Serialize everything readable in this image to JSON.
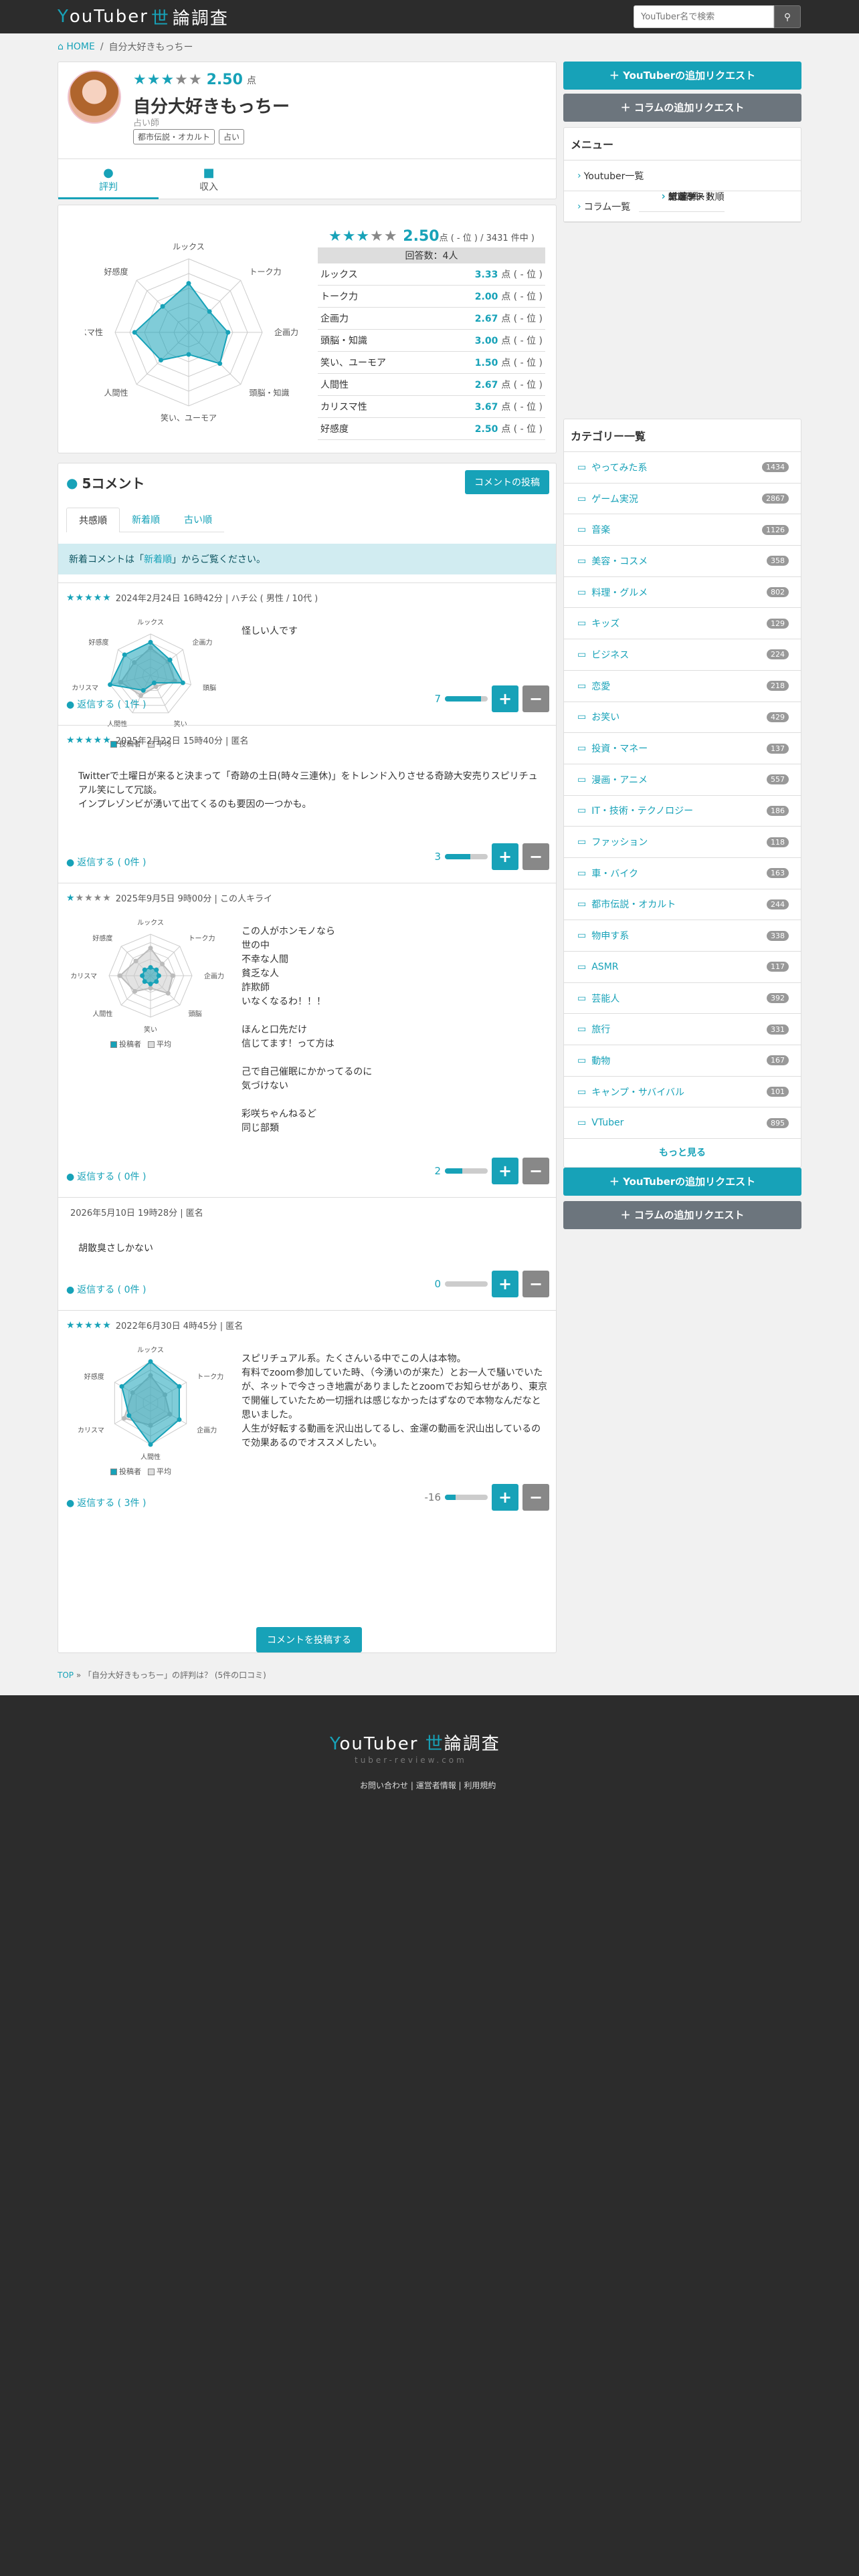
{
  "header": {
    "logo_y": "Y",
    "logo_text": "ouTuber",
    "logo_kanji_w": "世",
    "logo_kanji_rest": "論調査",
    "search_placeholder": "YouTuber名で検索",
    "search_icon": "search-icon"
  },
  "breadcrumb": {
    "home": "HOME",
    "sep": "/",
    "current": "自分大好きもっちー"
  },
  "profile": {
    "score": "2.50",
    "score_unit": "点",
    "stars_on": "★★★",
    "stars_off": "★★",
    "name": "自分大好きもっちー",
    "genre": "占い師",
    "tags": [
      "都市伝説・オカルト",
      "占い"
    ],
    "tabs": [
      {
        "label": "評判",
        "icon": "comment-icon"
      },
      {
        "label": "収入",
        "icon": "money-icon"
      }
    ]
  },
  "rating_summary": {
    "stars_on": "★★★",
    "stars_off": "★★",
    "score": "2.50",
    "rank_text": "点 ( - 位 ) ",
    "rank_total": "/ 3431 件中 )",
    "respondents": "回答数：4人",
    "rows": [
      {
        "label": "ルックス",
        "value": "3.33",
        "rank": "点 ( - 位 )"
      },
      {
        "label": "トーク力",
        "value": "2.00",
        "rank": "点 ( - 位 )"
      },
      {
        "label": "企画力",
        "value": "2.67",
        "rank": "点 ( - 位 )"
      },
      {
        "label": "頭脳・知識",
        "value": "3.00",
        "rank": "点 ( - 位 )"
      },
      {
        "label": "笑い、ユーモア",
        "value": "1.50",
        "rank": "点 ( - 位 )"
      },
      {
        "label": "人間性",
        "value": "2.67",
        "rank": "点 ( - 位 )"
      },
      {
        "label": "カリスマ性",
        "value": "3.67",
        "rank": "点 ( - 位 )"
      },
      {
        "label": "好感度",
        "value": "2.50",
        "rank": "点 ( - 位 )"
      }
    ],
    "radar_labels": [
      "ルックス",
      "トーク力",
      "企画力",
      "頭脳・知識",
      "笑い、ユーモア",
      "人間性",
      "カリスマ性",
      "好感度"
    ]
  },
  "chart_data": [
    {
      "type": "radar",
      "categories": [
        "ルックス",
        "トーク力",
        "企画力",
        "頭脳・知識",
        "笑い、ユーモア",
        "人間性",
        "カリスマ性",
        "好感度"
      ],
      "series": [
        {
          "values": [
            3.33,
            2.0,
            2.67,
            3.0,
            1.5,
            2.67,
            3.67,
            2.5
          ]
        }
      ],
      "ylim": [
        0,
        5
      ]
    }
  ],
  "comments_section": {
    "title": "5コメント",
    "post_button": "コメントの投稿",
    "sort_tabs": [
      "共感順",
      "新着順",
      "古い順"
    ],
    "notice_before": "新着コメントは「",
    "notice_link": "新着順",
    "notice_after": "」からご覧ください。",
    "bottom_post": "コメントを投稿する",
    "legend_user": "投稿者",
    "legend_avg": "平均"
  },
  "comments": [
    {
      "stars_on": "★★★★★",
      "stars_off": "",
      "meta": "2024年2月24日 16時42分 | ハチ公 ( 男性 / 10代 )",
      "text": "怪しい人です",
      "reply": "返信する ( 1件 )",
      "votes": "7",
      "vote_ratio": 0.85,
      "radar_labels": [
        "ルックス",
        "企画力",
        "頭脳",
        "笑い",
        "人間性",
        "カリスマ",
        "好感度"
      ],
      "radar_user": [
        4,
        3,
        4,
        1,
        2,
        5,
        4
      ],
      "radar_avg": [
        3.33,
        2.67,
        3.0,
        1.5,
        2.67,
        3.67,
        2.5
      ]
    },
    {
      "stars_on": "★★★★★",
      "stars_off": "",
      "meta": "2025年2月22日 15時40分 | 匿名",
      "text": "Twitterで土曜日が来ると決まって「奇跡の土日(時々三連休)」をトレンド入りさせる奇跡大安売りスピリチュアル笑にして冗談。\nインプレゾンビが湧いて出てくるのも要因の一つかも。",
      "reply": "返信する ( 0件 )",
      "votes": "3",
      "vote_ratio": 0.6
    },
    {
      "stars_on": "★",
      "stars_off": "★★★★",
      "meta": "2025年9月5日 9時00分 | この人キライ",
      "text": "この人がホンモノなら\n世の中\n不幸な人間\n貧乏な人\n詐欺師\nいなくなるわ！！！\n\nほんと口先だけ\n信じてます！って方は\n\n己で自己催眠にかかってるのに\n気づけない\n\n彩咲ちゃんねるど\n同じ部類",
      "reply": "返信する ( 0件 )",
      "votes": "2",
      "vote_ratio": 0.4,
      "radar_labels": [
        "ルックス",
        "トーク力",
        "企画力",
        "頭脳",
        "笑い",
        "人間性",
        "カリスマ",
        "好感度"
      ],
      "radar_user": [
        1,
        1,
        1,
        1,
        1,
        1,
        1,
        1
      ],
      "radar_avg": [
        3.33,
        2.0,
        2.67,
        3.0,
        1.5,
        2.67,
        3.67,
        2.5
      ]
    },
    {
      "stars_on": "",
      "stars_off": "",
      "meta": "2026年5月10日 19時28分 | 匿名",
      "text": "胡散臭さしかない",
      "reply": "返信する ( 0件 )",
      "votes": "0",
      "vote_ratio": 0.0
    },
    {
      "stars_on": "★★★★★",
      "stars_off": "",
      "meta": "2022年6月30日 4時45分 | 匿名",
      "text": "スピリチュアル系。たくさんいる中でこの人は本物。\n有料でzoom参加していた時、（今湧いのが来た）とお一人で騒いでいたが、ネットで今さっき地震がありましたとzoomでお知らせがあり、東京で開催していたため一切揺れは感じなかったはずなので本物なんだなと思いました。\n人生が好転する動画を沢山出してるし、金運の動画を沢山出しているので効果あるのでオススメしたい。",
      "reply": "返信する ( 3件 )",
      "votes": "-16",
      "vote_ratio": 0.25,
      "radar_labels": [
        "ルックス",
        "トーク力",
        "企画力",
        "人間性",
        "カリスマ",
        "好感度"
      ],
      "radar_user": [
        5,
        4,
        4,
        5,
        3,
        4
      ],
      "radar_avg": [
        3.33,
        2.0,
        2.67,
        2.67,
        3.67,
        2.5
      ]
    }
  ],
  "footer_crumb": {
    "top": "TOP",
    "sep": "»",
    "text": "「自分大好きもっちー」の評判は？ (5件の口コミ)"
  },
  "sidebar": {
    "add_youtuber": "YouTuberの追加リクエスト",
    "add_column": "コラムの追加リクエスト",
    "menu_title": "メニュー",
    "menu": [
      {
        "label": "Youtuber一覧",
        "sub": false
      },
      {
        "label": "50音順",
        "sub": true
      },
      {
        "label": "コメント数順",
        "sub": true
      },
      {
        "label": "新着",
        "sub": true
      },
      {
        "label": "コラム一覧",
        "sub": false
      },
      {
        "label": "総選挙",
        "sub": true
      },
      {
        "label": "アンケート",
        "sub": true
      },
      {
        "label": "ニュース",
        "sub": true
      }
    ],
    "category_title": "カテゴリー一覧",
    "categories": [
      {
        "label": "やってみた系",
        "count": "1434"
      },
      {
        "label": "ゲーム実況",
        "count": "2867"
      },
      {
        "label": "音楽",
        "count": "1126"
      },
      {
        "label": "美容・コスメ",
        "count": "358"
      },
      {
        "label": "料理・グルメ",
        "count": "802"
      },
      {
        "label": "キッズ",
        "count": "129"
      },
      {
        "label": "ビジネス",
        "count": "224"
      },
      {
        "label": "恋愛",
        "count": "218"
      },
      {
        "label": "お笑い",
        "count": "429"
      },
      {
        "label": "投資・マネー",
        "count": "137"
      },
      {
        "label": "漫画・アニメ",
        "count": "557"
      },
      {
        "label": "IT・技術・テクノロジー",
        "count": "186"
      },
      {
        "label": "ファッション",
        "count": "118"
      },
      {
        "label": "車・バイク",
        "count": "163"
      },
      {
        "label": "都市伝説・オカルト",
        "count": "244"
      },
      {
        "label": "物申す系",
        "count": "338"
      },
      {
        "label": "ASMR",
        "count": "117"
      },
      {
        "label": "芸能人",
        "count": "392"
      },
      {
        "label": "旅行",
        "count": "331"
      },
      {
        "label": "動物",
        "count": "167"
      },
      {
        "label": "キャンプ・サバイバル",
        "count": "101"
      },
      {
        "label": "VTuber",
        "count": "895"
      }
    ],
    "more": "もっと見る"
  },
  "footer": {
    "links": [
      "お問い合わせ",
      "運営者情報",
      "利用規約"
    ],
    "sub": "tuber-review.com"
  },
  "colors": {
    "accent": "#17a2b8",
    "dark": "#2c2c2c"
  }
}
